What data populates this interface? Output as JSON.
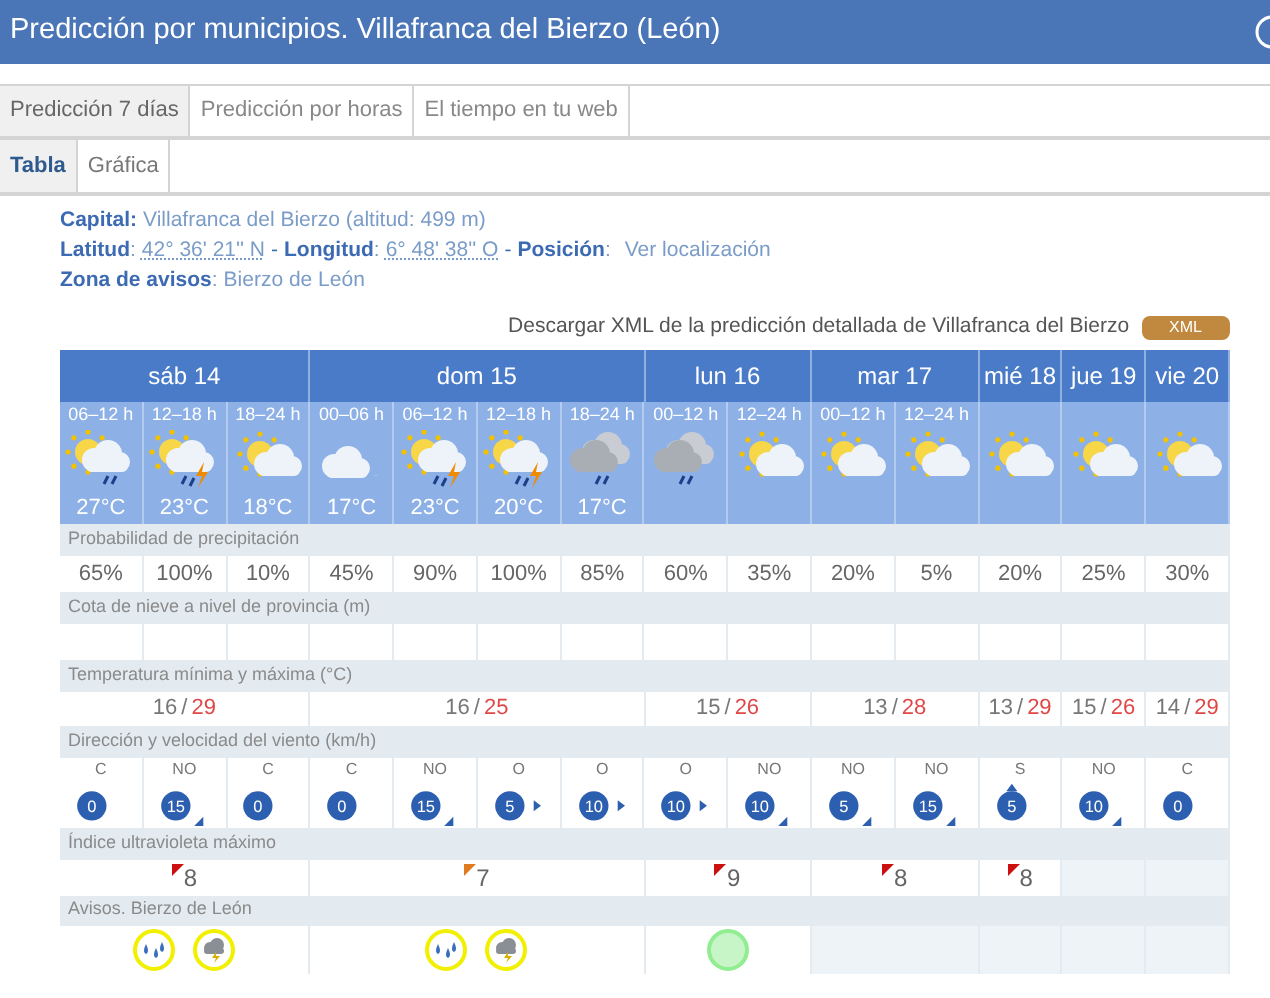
{
  "window": {
    "title": "Predicción por municipios. Villafranca del Bierzo (León)"
  },
  "tabs": [
    {
      "label": "Predicción 7 días",
      "selected": true
    },
    {
      "label": "Predicción por horas",
      "selected": false
    },
    {
      "label": "El tiempo en tu web",
      "selected": false
    }
  ],
  "subtabs": [
    {
      "label": "Tabla",
      "selected": true
    },
    {
      "label": "Gráfica",
      "selected": false
    }
  ],
  "info": [
    [
      {
        "kind": "label",
        "text": "Capital:"
      },
      {
        "kind": "value",
        "text": "Villafranca del Bierzo (altitud: 499 m)"
      }
    ],
    [
      {
        "kind": "label",
        "text": "Latitud"
      },
      {
        "kind": "plain",
        "text": ":"
      },
      {
        "kind": "coord",
        "text": "42° 36' 21'' N"
      },
      {
        "kind": "dash",
        "text": "-"
      },
      {
        "kind": "label",
        "text": "Longitud"
      },
      {
        "kind": "plain",
        "text": ":"
      },
      {
        "kind": "coord",
        "text": "6° 48' 38'' O"
      },
      {
        "kind": "dash",
        "text": "-"
      },
      {
        "kind": "label",
        "text": "Posición"
      },
      {
        "kind": "plain",
        "text": ":"
      },
      {
        "kind": "link",
        "text": "Ver localización"
      }
    ],
    [
      {
        "kind": "label",
        "text": "Zona de avisos"
      },
      {
        "kind": "plain",
        "text": ":"
      },
      {
        "kind": "value",
        "text": "Bierzo de León"
      }
    ]
  ],
  "download": {
    "text": "Descargar XML de la predicción detallada de Villafranca del Bierzo",
    "badge": "XML"
  },
  "row_labels": {
    "precip": "Probabilidad de precipitación",
    "snow": "Cota de nieve a nivel de provincia (m)",
    "temp": "Temperatura mínima y máxima (°C)",
    "wind": "Dirección y velocidad del viento (km/h)",
    "uv": "Índice ultravioleta máximo",
    "warnings": "Avisos. Bierzo de León"
  },
  "days": [
    {
      "label": "sáb 14",
      "temp_min": "16",
      "separator": "/",
      "temp_max": "29",
      "uv": {
        "value": "8",
        "color": "#cc1010"
      },
      "periods": [
        {
          "hours": "06–12 h",
          "kind": "sun_cloud_rain",
          "temp": "27°C",
          "precip": "65%",
          "wind": {
            "direction": "C",
            "speed": "0",
            "kind": "calm"
          }
        },
        {
          "hours": "12–18 h",
          "kind": "sun_cloud_storm",
          "temp": "23°C",
          "precip": "100%",
          "wind": {
            "direction": "NO",
            "speed": "15",
            "kind": "se"
          }
        },
        {
          "hours": "18–24 h",
          "kind": "sun_cloud",
          "temp": "18°C",
          "precip": "10%",
          "wind": {
            "direction": "C",
            "speed": "0",
            "kind": "calm"
          }
        }
      ],
      "warnings": [
        {
          "kind": "rain",
          "color": "#f0f000"
        },
        {
          "kind": "storm",
          "color": "#f0f000"
        }
      ]
    },
    {
      "label": "dom 15",
      "temp_min": "16",
      "separator": "/",
      "temp_max": "25",
      "uv": {
        "value": "7",
        "color": "#e07b20"
      },
      "periods": [
        {
          "hours": "00–06 h",
          "kind": "moon_cloud",
          "temp": "17°C",
          "precip": "45%",
          "wind": {
            "direction": "C",
            "speed": "0",
            "kind": "calm"
          }
        },
        {
          "hours": "06–12 h",
          "kind": "sun_cloud_storm",
          "temp": "23°C",
          "precip": "90%",
          "wind": {
            "direction": "NO",
            "speed": "15",
            "kind": "se"
          }
        },
        {
          "hours": "12–18 h",
          "kind": "sun_cloud_storm",
          "temp": "20°C",
          "precip": "100%",
          "wind": {
            "direction": "O",
            "speed": "5",
            "kind": "e"
          }
        },
        {
          "hours": "18–24 h",
          "kind": "cloud_rain",
          "temp": "17°C",
          "precip": "85%",
          "wind": {
            "direction": "O",
            "speed": "10",
            "kind": "e"
          }
        }
      ],
      "warnings": [
        {
          "kind": "rain",
          "color": "#f0f000"
        },
        {
          "kind": "storm",
          "color": "#f0f000"
        }
      ]
    },
    {
      "label": "lun 16",
      "temp_min": "15",
      "separator": "/",
      "temp_max": "26",
      "uv": {
        "value": "9",
        "color": "#cc1010"
      },
      "periods": [
        {
          "hours": "00–12 h",
          "kind": "cloud_rain",
          "precip": "60%",
          "wind": {
            "direction": "O",
            "speed": "10",
            "kind": "e"
          }
        },
        {
          "hours": "12–24 h",
          "kind": "sun_cloud",
          "precip": "35%",
          "wind": {
            "direction": "NO",
            "speed": "10",
            "kind": "se"
          }
        }
      ],
      "warnings": [
        {
          "kind": "none",
          "color": "#90ee90"
        }
      ]
    },
    {
      "label": "mar 17",
      "temp_min": "13",
      "separator": "/",
      "temp_max": "28",
      "uv": {
        "value": "8",
        "color": "#cc1010"
      },
      "periods": [
        {
          "hours": "00–12 h",
          "kind": "sun_cloud",
          "precip": "20%",
          "wind": {
            "direction": "NO",
            "speed": "5",
            "kind": "se"
          }
        },
        {
          "hours": "12–24 h",
          "kind": "sun_cloud",
          "precip": "5%",
          "wind": {
            "direction": "NO",
            "speed": "15",
            "kind": "se"
          }
        }
      ]
    },
    {
      "label": "mié 18",
      "temp_min": "13",
      "separator": "/",
      "temp_max": "29",
      "uv": {
        "value": "8",
        "color": "#cc1010"
      },
      "periods": [
        {
          "kind": "sun_cloud",
          "precip": "20%",
          "wind": {
            "direction": "S",
            "speed": "5",
            "kind": "n"
          }
        }
      ]
    },
    {
      "label": "jue 19",
      "temp_min": "15",
      "separator": "/",
      "temp_max": "26",
      "periods": [
        {
          "kind": "sun_cloud",
          "precip": "25%",
          "wind": {
            "direction": "NO",
            "speed": "10",
            "kind": "se"
          }
        }
      ]
    },
    {
      "label": "vie 20",
      "temp_min": "14",
      "separator": "/",
      "temp_max": "29",
      "periods": [
        {
          "kind": "sun_cloud",
          "precip": "30%",
          "wind": {
            "direction": "C",
            "speed": "0",
            "kind": "calm"
          }
        }
      ]
    }
  ]
}
